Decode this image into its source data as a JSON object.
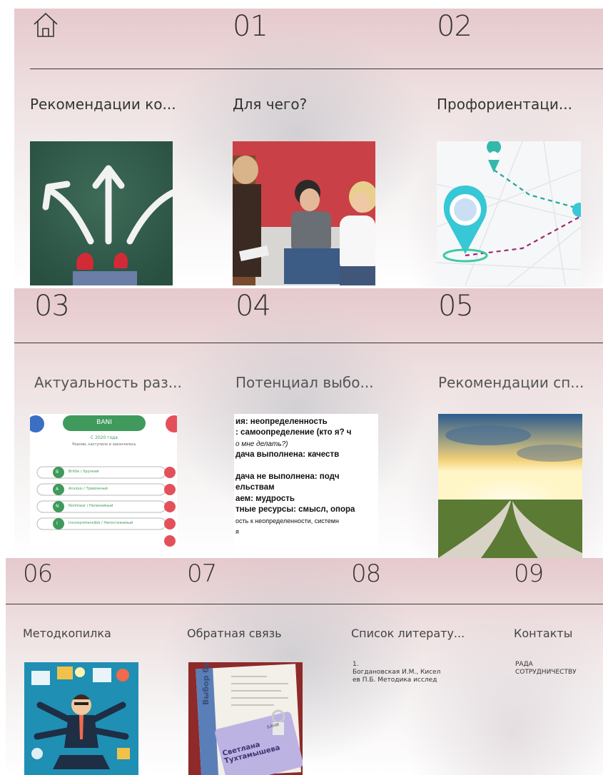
{
  "sections": [
    {
      "number": "",
      "title": "Рекомендации ко...",
      "icon": "home-icon"
    },
    {
      "number": "01",
      "title": "Для чего?"
    },
    {
      "number": "02",
      "title": "Профориентаци..."
    },
    {
      "number": "03",
      "title": "Актуальность раз..."
    },
    {
      "number": "04",
      "title": "Потенциал выбо..."
    },
    {
      "number": "05",
      "title": "Рекомендации сп..."
    },
    {
      "number": "06",
      "title": "Методкопилка"
    },
    {
      "number": "07",
      "title": "Обратная связь"
    },
    {
      "number": "08",
      "title": "Список литерату...",
      "snippet": "1.\nБогдановская И.М., Кисел\nев П.Б. Методика исслед"
    },
    {
      "number": "09",
      "title": "Контакты",
      "snippet": "РАДА\nСОТРУДНИЧЕСТВУ"
    }
  ],
  "tile_text": {
    "bani_title": "BANI",
    "bani_year": "С 2020 года",
    "bani_sub": "Реалии, наступило и закончилось",
    "bani_rows": [
      "Brittle / Хрупкий",
      "Anxious / Тревожный",
      "Nonlinear / Нелинейный",
      "Incomprehensible / Непостижимый"
    ],
    "bani_letters": [
      "B",
      "A",
      "N",
      "I"
    ],
    "doc_lines": [
      "ия: неопределенность",
      ": самоопределение (кто я? ч",
      "о мне делать?)",
      "дача выполнена: качеств",
      "",
      "дача не выполнена: подч",
      "ельствам",
      "аем: мудрость",
      "тные ресурсы: смысл, опора",
      "ость к неопределенности, системн",
      "я"
    ],
    "book_spine": "Выбор будущего",
    "book_author": "Светлана Тухтамышева",
    "book_title": "БАНИ"
  }
}
